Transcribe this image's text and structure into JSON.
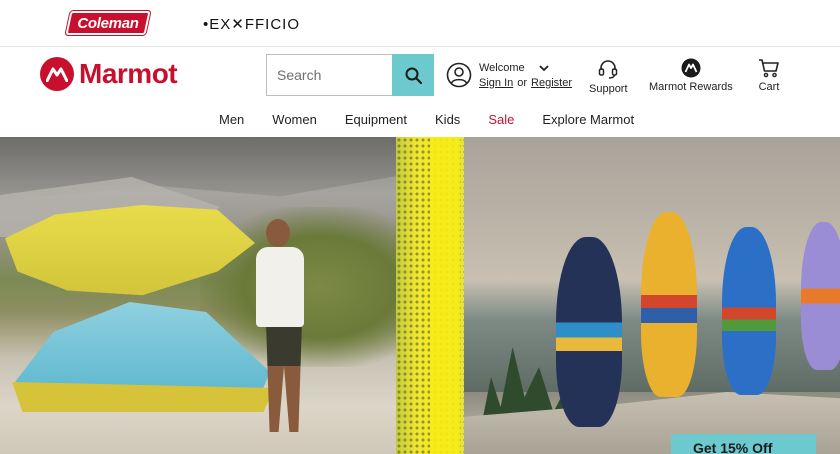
{
  "brand_strip": {
    "coleman_label": "Coleman",
    "exofficio_label": "•EX✕FFICIO"
  },
  "header": {
    "logo_text": "Marmot",
    "search": {
      "placeholder": "Search",
      "value": ""
    },
    "account": {
      "welcome": "Welcome",
      "sign_in": "Sign In",
      "or": "or",
      "register": "Register"
    },
    "support_label": "Support",
    "rewards_label": "Marmot Rewards",
    "cart_label": "Cart"
  },
  "nav": {
    "items": [
      {
        "label": "Men"
      },
      {
        "label": "Women"
      },
      {
        "label": "Equipment"
      },
      {
        "label": "Kids"
      },
      {
        "label": "Sale"
      },
      {
        "label": "Explore Marmot"
      }
    ]
  },
  "hero": {
    "promo_text": "Get 15% Off"
  },
  "colors": {
    "brand_red": "#c8102e",
    "accent_teal": "#6ccacf"
  },
  "icons": [
    "search-icon",
    "account-icon",
    "chevron-down-icon",
    "support-headset-icon",
    "rewards-icon",
    "cart-icon"
  ]
}
